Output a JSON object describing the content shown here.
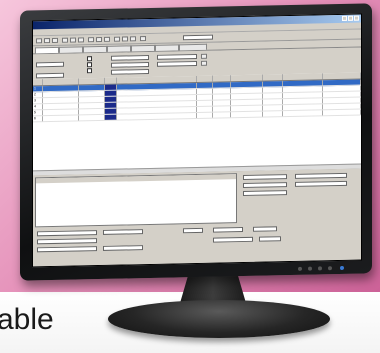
{
  "background": {
    "word": "able",
    "colors": {
      "pink": "#e48fb8",
      "white": "#ffffff"
    }
  },
  "app": {
    "title": "",
    "menu": [
      "",
      "",
      "",
      "",
      "",
      ""
    ],
    "toolbar": {
      "field_label": "",
      "field_value": ""
    },
    "tabs": [
      "",
      "",
      "",
      "",
      "",
      "",
      ""
    ],
    "form": {
      "labels": [
        "",
        "",
        "",
        ""
      ],
      "values": [
        "",
        "",
        "",
        ""
      ]
    },
    "grid": {
      "headers": [
        "",
        "",
        "",
        "",
        "",
        "",
        "",
        "",
        "",
        "",
        ""
      ],
      "rows": [
        [
          "1",
          "",
          "",
          "",
          "",
          "",
          "",
          "",
          "",
          "",
          ""
        ],
        [
          "2",
          "",
          "",
          "",
          "",
          "",
          "",
          "",
          "",
          "",
          ""
        ],
        [
          "3",
          "",
          "",
          "",
          "",
          "",
          "",
          "",
          "",
          "",
          ""
        ],
        [
          "4",
          "",
          "",
          "",
          "",
          "",
          "",
          "",
          "",
          "",
          ""
        ],
        [
          "5",
          "",
          "",
          "",
          "",
          "",
          "",
          "",
          "",
          "",
          ""
        ],
        [
          "6",
          "",
          "",
          "",
          "",
          "",
          "",
          "",
          "",
          "",
          ""
        ]
      ],
      "selected_row": 0
    },
    "stats": {
      "headers": [
        "",
        "",
        "",
        "",
        "",
        "",
        "",
        ""
      ],
      "rows": [
        [
          "",
          "",
          "",
          "",
          "",
          "",
          "",
          ""
        ],
        [
          "",
          "",
          "",
          "",
          "",
          "",
          "",
          ""
        ],
        [
          "",
          "",
          "",
          "",
          "",
          "",
          "",
          ""
        ],
        [
          "",
          "",
          "",
          "",
          "",
          "",
          "",
          ""
        ]
      ]
    }
  }
}
